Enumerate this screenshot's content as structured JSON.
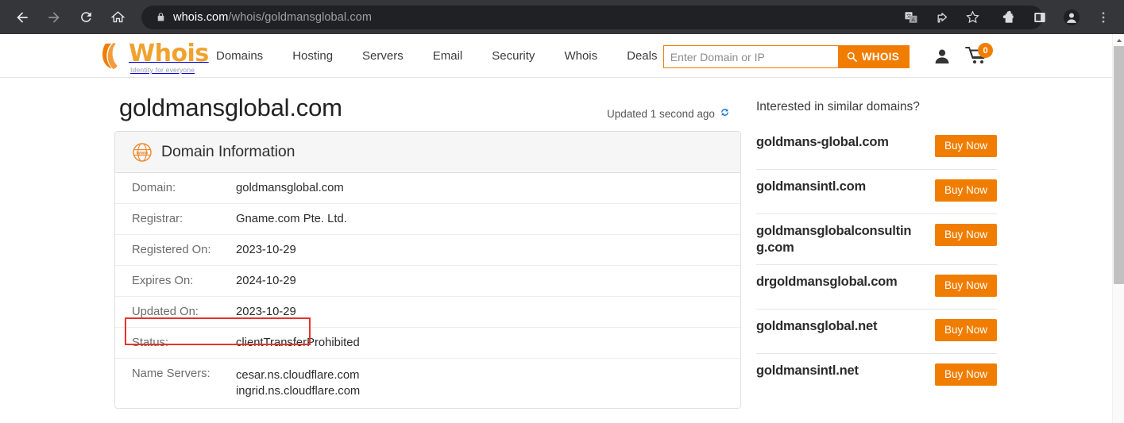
{
  "browser": {
    "back_icon": "arrow-left-icon",
    "forward_icon": "arrow-right-icon",
    "reload_icon": "reload-icon",
    "home_icon": "home-icon",
    "lock_icon": "lock-icon",
    "url_host": "whois.com",
    "url_path": "/whois/goldmansglobal.com",
    "right_icons": [
      "translate-icon",
      "share-icon",
      "star-icon",
      "extensions-icon",
      "side-panel-icon",
      "profile-icon",
      "more-menu-icon"
    ]
  },
  "header": {
    "logo_word": "Whois",
    "logo_tagline": "Identity for everyone",
    "nav": [
      {
        "label": "Domains"
      },
      {
        "label": "Hosting"
      },
      {
        "label": "Servers"
      },
      {
        "label": "Email"
      },
      {
        "label": "Security"
      },
      {
        "label": "Whois"
      },
      {
        "label": "Deals"
      }
    ],
    "search": {
      "placeholder": "Enter Domain or IP",
      "value": "",
      "button_label": "WHOIS",
      "button_icon": "search-icon"
    },
    "account_icon": "user-icon",
    "cart_icon": "cart-icon",
    "cart_count": "0"
  },
  "main": {
    "page_title": "goldmansglobal.com",
    "updated_text": "Updated 1 second ago",
    "refresh_icon": "refresh-icon",
    "card": {
      "icon": "www-globe-icon",
      "title": "Domain Information",
      "rows": [
        {
          "key": "Domain:",
          "value": "goldmansglobal.com",
          "highlight": false
        },
        {
          "key": "Registrar:",
          "value": "Gname.com Pte. Ltd.",
          "highlight": false
        },
        {
          "key": "Registered On:",
          "value": "2023-10-29",
          "highlight": true
        },
        {
          "key": "Expires On:",
          "value": "2024-10-29",
          "highlight": false
        },
        {
          "key": "Updated On:",
          "value": "2023-10-29",
          "highlight": false
        },
        {
          "key": "Status:",
          "value": "clientTransferProhibited",
          "highlight": false
        },
        {
          "key": "Name Servers:",
          "value": "cesar.ns.cloudflare.com\ningrid.ns.cloudflare.com",
          "highlight": false
        }
      ]
    }
  },
  "sidebar": {
    "title": "Interested in similar domains?",
    "items": [
      {
        "domain": "goldmans-global.com",
        "button_label": "Buy Now"
      },
      {
        "domain": "goldmansintl.com",
        "button_label": "Buy Now"
      },
      {
        "domain": "goldmansglobalconsulting.com",
        "button_label": "Buy Now"
      },
      {
        "domain": "drgoldmansglobal.com",
        "button_label": "Buy Now"
      },
      {
        "domain": "goldmansglobal.net",
        "button_label": "Buy Now"
      },
      {
        "domain": "goldmansintl.net",
        "button_label": "Buy Now"
      }
    ]
  },
  "colors": {
    "brand_orange": "#f07d00",
    "logo_orange": "#f0a22e",
    "highlight_red": "#e8332a",
    "chrome_bg": "#35363a",
    "omnibox_bg": "#202124",
    "refresh_blue": "#1a73c8"
  }
}
